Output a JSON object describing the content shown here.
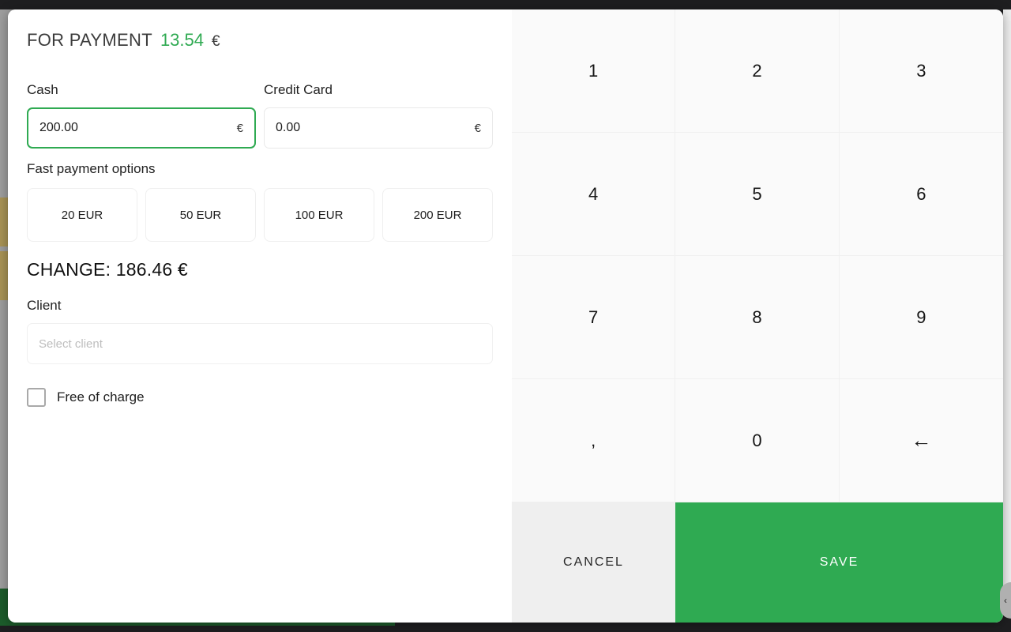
{
  "dialog": {
    "title": "FOR PAYMENT",
    "amount": "13.54",
    "currency": "€"
  },
  "cash": {
    "label": "Cash",
    "value": "200.00",
    "suffix": "€"
  },
  "credit_card": {
    "label": "Credit Card",
    "value": "0.00",
    "suffix": "€"
  },
  "fast_payment": {
    "label": "Fast payment options",
    "options": [
      {
        "label": "20 EUR"
      },
      {
        "label": "50 EUR"
      },
      {
        "label": "100 EUR"
      },
      {
        "label": "200 EUR"
      }
    ]
  },
  "change": {
    "text": "CHANGE: 186.46 €"
  },
  "client": {
    "label": "Client",
    "placeholder": "Select client",
    "value": ""
  },
  "free_of_charge": {
    "label": "Free of charge",
    "checked": false
  },
  "keypad": {
    "keys": [
      {
        "label": "1",
        "name": "key-1"
      },
      {
        "label": "2",
        "name": "key-2"
      },
      {
        "label": "3",
        "name": "key-3"
      },
      {
        "label": "4",
        "name": "key-4"
      },
      {
        "label": "5",
        "name": "key-5"
      },
      {
        "label": "6",
        "name": "key-6"
      },
      {
        "label": "7",
        "name": "key-7"
      },
      {
        "label": "8",
        "name": "key-8"
      },
      {
        "label": "9",
        "name": "key-9"
      },
      {
        "label": ",",
        "name": "key-decimal-comma"
      },
      {
        "label": "0",
        "name": "key-0"
      },
      {
        "label": "←",
        "name": "key-backspace"
      }
    ]
  },
  "actions": {
    "cancel_label": "CANCEL",
    "save_label": "SAVE"
  },
  "edge": {
    "handle_icon": "chevron-left-icon",
    "handle_glyph": "‹"
  },
  "colors": {
    "accent_green": "#2faa52",
    "dark_green_bar": "#1c5c2b",
    "keypad_bg": "#fafafa",
    "cancel_bg": "#efefef",
    "khaki_chip": "#a89355",
    "sidebar_gray": "#9e9e9e"
  }
}
